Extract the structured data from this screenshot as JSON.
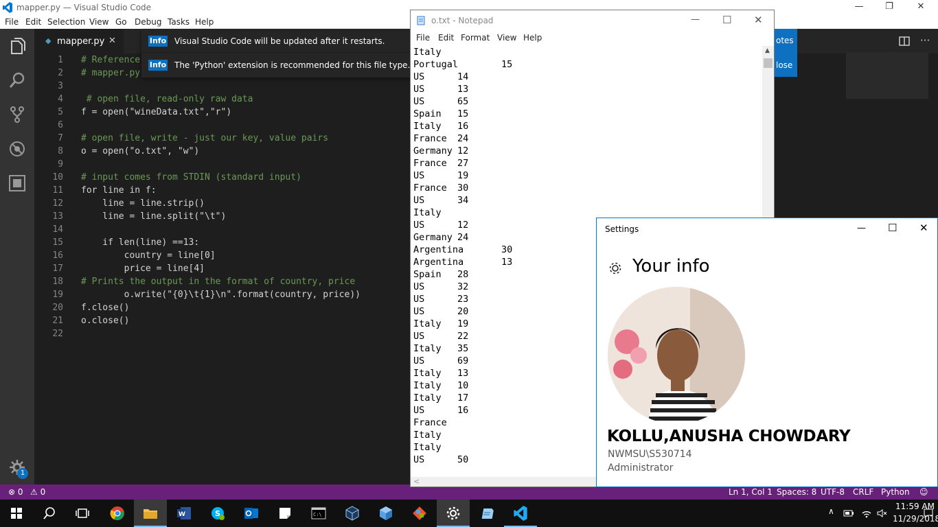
{
  "vscode": {
    "title": "mapper.py — Visual Studio Code",
    "menu": [
      "File",
      "Edit",
      "Selection",
      "View",
      "Go",
      "Debug",
      "Tasks",
      "Help"
    ],
    "tab": "mapper.py",
    "notifications": [
      {
        "badge": "Info",
        "message": "Visual Studio Code will be updated after it restarts.",
        "action": "otes"
      },
      {
        "badge": "Info",
        "message": "The 'Python' extension is recommended for this file type.",
        "action": "lose"
      }
    ],
    "lines": [
      "# Reference",
      "# mapper.py",
      "",
      " # open file, read-only raw data",
      "f = open(\"wineData.txt\",\"r\")",
      "",
      "# open file, write - just our key, value pairs",
      "o = open(\"o.txt\", \"w\")",
      "",
      "# input comes from STDIN (standard input)",
      "for line in f:",
      "    line = line.strip()",
      "    line = line.split(\"\\t\")",
      "",
      "    if len(line) ==13:",
      "        country = line[0]",
      "        price = line[4]",
      "# Prints the output in the format of country, price",
      "        o.write(\"{0}\\t{1}\\n\".format(country, price))",
      "f.close()",
      "o.close()",
      ""
    ],
    "line_numbers": [
      "1",
      "2",
      "3",
      "4",
      "5",
      "6",
      "7",
      "8",
      "9",
      "10",
      "11",
      "12",
      "13",
      "14",
      "15",
      "16",
      "17",
      "18",
      "19",
      "20",
      "21",
      "22"
    ],
    "status": {
      "errors": "⊗ 0",
      "warnings": "⚠ 0",
      "position": "Ln 1, Col 1",
      "spaces": "Spaces: 8",
      "encoding": "UTF-8",
      "eol": "CRLF",
      "language": "Python",
      "notification_count": "1"
    }
  },
  "notepad": {
    "title": "o.txt - Notepad",
    "menu": [
      "File",
      "Edit",
      "Format",
      "View",
      "Help"
    ],
    "rows": [
      [
        "Italy",
        ""
      ],
      [
        "Portugal",
        "15"
      ],
      [
        "US",
        "14"
      ],
      [
        "US",
        "13"
      ],
      [
        "US",
        "65"
      ],
      [
        "Spain",
        "15"
      ],
      [
        "Italy",
        "16"
      ],
      [
        "France",
        "24"
      ],
      [
        "Germany",
        "12"
      ],
      [
        "France",
        "27"
      ],
      [
        "US",
        "19"
      ],
      [
        "France",
        "30"
      ],
      [
        "US",
        "34"
      ],
      [
        "Italy",
        ""
      ],
      [
        "US",
        "12"
      ],
      [
        "Germany",
        "24"
      ],
      [
        "Argentina",
        "30"
      ],
      [
        "Argentina",
        "13"
      ],
      [
        "Spain",
        "28"
      ],
      [
        "US",
        "32"
      ],
      [
        "US",
        "23"
      ],
      [
        "US",
        "20"
      ],
      [
        "Italy",
        "19"
      ],
      [
        "US",
        "22"
      ],
      [
        "Italy",
        "35"
      ],
      [
        "US",
        "69"
      ],
      [
        "Italy",
        "13"
      ],
      [
        "Italy",
        "10"
      ],
      [
        "Italy",
        "17"
      ],
      [
        "US",
        "16"
      ],
      [
        "France",
        ""
      ],
      [
        "Italy",
        ""
      ],
      [
        "Italy",
        ""
      ],
      [
        "US",
        "50"
      ]
    ]
  },
  "settings": {
    "title": "Settings",
    "heading": "Your info",
    "name": "KOLLU,ANUSHA CHOWDARY",
    "account": "NWMSU\\S530714",
    "role": "Administrator"
  },
  "taskbar": {
    "time": "11:59 AM",
    "date": "11/29/2018"
  },
  "colors": {
    "statusbar": "#68217a",
    "info_badge": "#0e70c0",
    "settings_border": "#0078d7"
  }
}
